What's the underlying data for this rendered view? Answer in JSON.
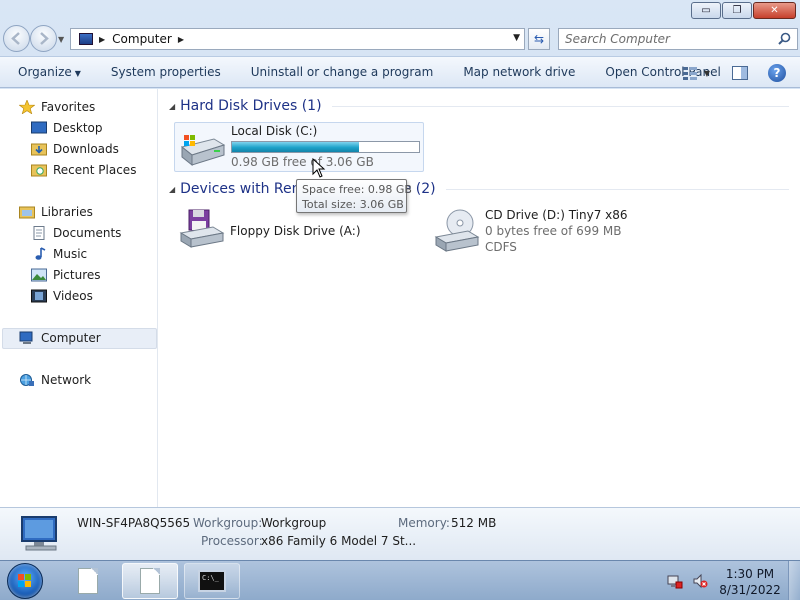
{
  "window": {
    "minimize_label": "▭",
    "maximize_label": "❐",
    "close_label": "✕"
  },
  "address": {
    "crumb": "Computer",
    "search_placeholder": "Search Computer"
  },
  "toolbar": {
    "organize": "Organize",
    "system_properties": "System properties",
    "uninstall": "Uninstall or change a program",
    "map_drive": "Map network drive",
    "control_panel": "Open Control Panel",
    "help": "?"
  },
  "sidebar": {
    "favorites": "Favorites",
    "desktop": "Desktop",
    "downloads": "Downloads",
    "recent_places": "Recent Places",
    "libraries": "Libraries",
    "documents": "Documents",
    "music": "Music",
    "pictures": "Pictures",
    "videos": "Videos",
    "computer": "Computer",
    "network": "Network"
  },
  "groups": {
    "hard_disks": "Hard Disk Drives (1)",
    "removable": "Devices with Removable Storage (2)"
  },
  "drives": {
    "local_disk": {
      "name": "Local Disk (C:)",
      "free_text": "0.98 GB free of 3.06 GB",
      "used_fraction": 0.68
    },
    "floppy": {
      "name": "Floppy Disk Drive (A:)"
    },
    "cd": {
      "name": "CD Drive (D:) Tiny7 x86",
      "free_text": "0 bytes free of 699 MB",
      "fs": "CDFS"
    }
  },
  "tooltip": {
    "space_free": "Space free: 0.98 GB",
    "total_size": "Total size: 3.06 GB"
  },
  "details": {
    "computer_name": "WIN-SF4PA8Q5565",
    "workgroup_label": "Workgroup:",
    "workgroup_value": "Workgroup",
    "memory_label": "Memory:",
    "memory_value": "512 MB",
    "processor_label": "Processor:",
    "processor_value": "x86 Family 6 Model 7 St..."
  },
  "taskbar": {
    "cmd_text": "C:\\_",
    "time": "1:30 PM",
    "date": "8/31/2022"
  },
  "colors": {
    "usage_bar": "#1da2c9",
    "group_title": "#1e3287",
    "toolbar_text": "#1e395b"
  }
}
